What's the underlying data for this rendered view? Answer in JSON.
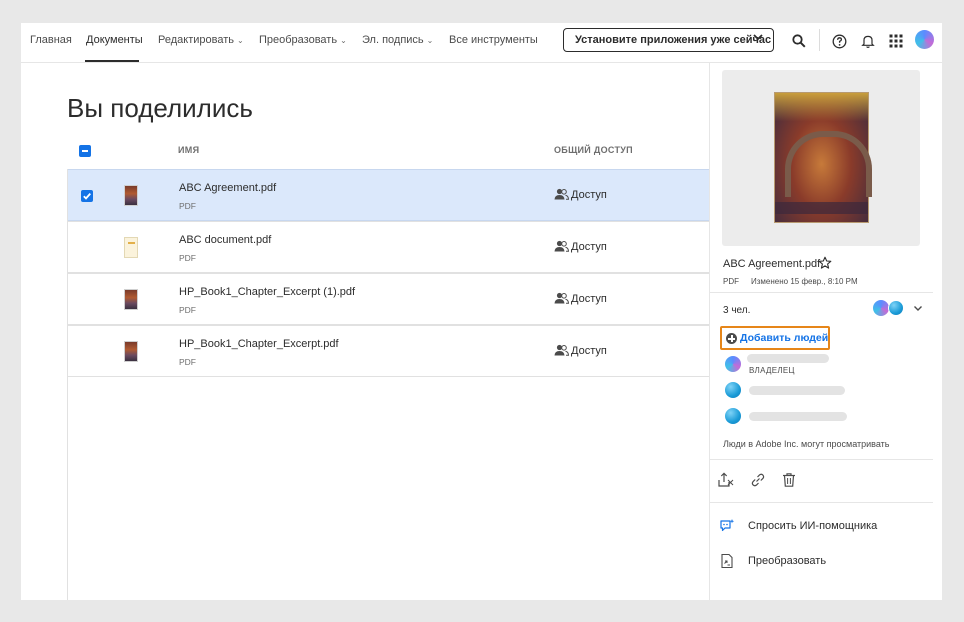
{
  "nav": {
    "items": [
      {
        "label": "Главная"
      },
      {
        "label": "Документы"
      },
      {
        "label": "Редактировать"
      },
      {
        "label": "Преобразовать"
      },
      {
        "label": "Эл. подпись"
      },
      {
        "label": "Все инструменты"
      }
    ],
    "active": "Документы",
    "install_button": "Установите приложения уже сейчас",
    "icons": [
      "search-icon",
      "help-icon",
      "bell-icon",
      "apps-grid-icon",
      "user-avatar"
    ]
  },
  "main": {
    "title": "Вы поделились",
    "columns": {
      "name": "ИМЯ",
      "sharing": "ОБЩИЙ ДОСТУП"
    },
    "files": [
      {
        "name": "ABC Agreement.pdf",
        "type": "PDF",
        "access": "Доступ",
        "selected": true,
        "thumb": "book-cover"
      },
      {
        "name": "ABC document.pdf",
        "type": "PDF",
        "access": "Доступ",
        "selected": false,
        "thumb": "document"
      },
      {
        "name": "HP_Book1_Chapter_Excerpt (1).pdf",
        "type": "PDF",
        "access": "Доступ",
        "selected": false,
        "thumb": "book-cover"
      },
      {
        "name": "HP_Book1_Chapter_Excerpt.pdf",
        "type": "PDF",
        "access": "Доступ",
        "selected": false,
        "thumb": "book-cover"
      }
    ]
  },
  "panel": {
    "file_name": "ABC Agreement.pdf",
    "file_type": "PDF",
    "modified": "Изменено 15 февр., 8:10 PM",
    "people_count": "3 чел.",
    "add_people": "Добавить людей",
    "owner_label": "ВЛАДЕЛЕЦ",
    "people_note": "Люди в Adobe Inc. могут просматривать",
    "actions": [
      {
        "label": "Спросить ИИ-помощника",
        "icon": "ai-assistant-icon"
      },
      {
        "label": "Преобразовать",
        "icon": "convert-icon"
      }
    ],
    "toolbar_icons": [
      "share-upload-icon",
      "link-icon",
      "trash-icon"
    ]
  },
  "colors": {
    "accent": "#1473e6",
    "highlight": "#e68619",
    "selected_row": "#dbe8fb"
  }
}
